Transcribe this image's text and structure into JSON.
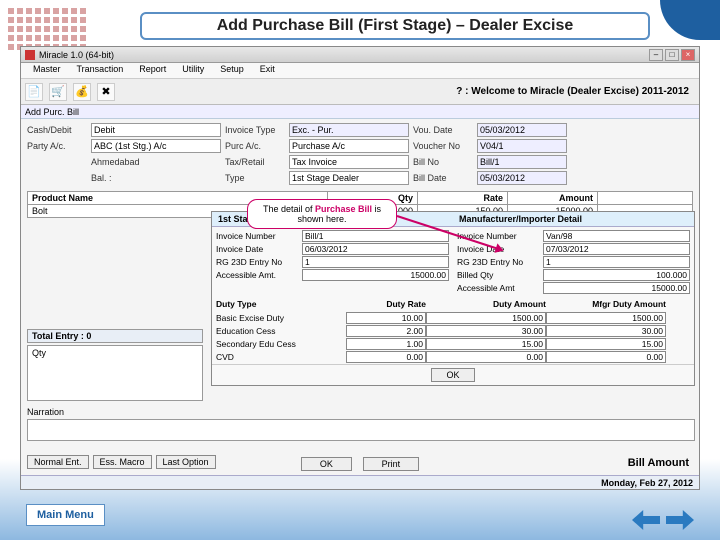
{
  "slide": {
    "title": "Add Purchase Bill (First Stage) – Dealer Excise",
    "main_menu": "Main Menu"
  },
  "window": {
    "title": "Miracle 1.0 (64-bit)",
    "welcome": "? : Welcome to Miracle (Dealer Excise) 2011-2012",
    "screen_name": "Add Purc. Bill",
    "status_date": "Monday, Feb 27, 2012"
  },
  "menu": {
    "m1": "Master",
    "m2": "Transaction",
    "m3": "Report",
    "m4": "Utility",
    "m5": "Setup",
    "m6": "Exit"
  },
  "icons": {
    "new": "📄",
    "cart": "🛒",
    "bag": "💰",
    "x": "✖"
  },
  "header": {
    "cash_debit_lbl": "Cash/Debit",
    "cash_debit": "Debit",
    "invoice_type_lbl": "Invoice Type",
    "invoice_type": "Exc. - Pur.",
    "vou_date_lbl": "Vou. Date",
    "vou_date": "05/03/2012",
    "party_lbl": "Party A/c.",
    "party": "ABC (1st Stg.) A/c",
    "purc_lbl": "Purc A/c.",
    "purc": "Purchase A/c",
    "voucher_no_lbl": "Voucher No",
    "voucher_no": "V04/1",
    "city": "Ahmedabad",
    "tax_lbl": "Tax/Retail",
    "tax": "Tax Invoice",
    "bill_no_lbl": "Bill No",
    "bill_no": "Bill/1",
    "bal_lbl": "Bal. :",
    "type_lbl": "Type",
    "type": "1st Stage Dealer",
    "bill_date_lbl": "Bill Date",
    "bill_date": "05/03/2012"
  },
  "grid": {
    "col1": "Product Name",
    "col2": "Qty",
    "col3": "Rate",
    "col4": "Amount",
    "p": "Bolt",
    "q": "100.000",
    "r": "150.00",
    "a": "15000.00"
  },
  "callout": {
    "pre": "The detail of ",
    "hl": "Purchase Bill",
    "post": " is shown here."
  },
  "detail": {
    "t1": "1st Stage Dealer Detail",
    "t2": "Manufacturer/Importer Detail",
    "inv_no_l": "Invoice Number",
    "inv_no_1": "Bill/1",
    "inv_no_2": "Van/98",
    "inv_dt_l": "Invoice Date",
    "inv_dt_1": "06/03/2012",
    "inv_dt_2": "07/03/2012",
    "rg_l": "RG 23D Entry No",
    "rg_1": "1",
    "rg_2": "1",
    "acc_l": "Accessible Amt.",
    "acc": "15000.00",
    "bq_l": "Billed Qty",
    "bq": "100.000",
    "acc2_l": "Accessible Amt",
    "acc2": "15000.00"
  },
  "duty": {
    "h1": "Duty Type",
    "h2": "Duty Rate",
    "h3": "Duty Amount",
    "h4": "Mfgr Duty Amount",
    "r1": "Basic Excise Duty",
    "r1r": "10.00",
    "r1a": "1500.00",
    "r1m": "1500.00",
    "r2": "Education Cess",
    "r2r": "2.00",
    "r2a": "30.00",
    "r2m": "30.00",
    "r3": "Secondary Edu Cess",
    "r3r": "1.00",
    "r3a": "15.00",
    "r3m": "15.00",
    "r4": "CVD",
    "r4r": "0.00",
    "r4a": "0.00",
    "r4m": "0.00",
    "ok": "OK"
  },
  "footer": {
    "total_entry": "Total Entry : 0",
    "qty": "Qty",
    "narration": "Narration",
    "ok": "OK",
    "print": "Print",
    "bill_amount": "Bill Amount",
    "b1": "Normal Ent.",
    "b2": "Ess. Macro",
    "b3": "Last Option"
  }
}
